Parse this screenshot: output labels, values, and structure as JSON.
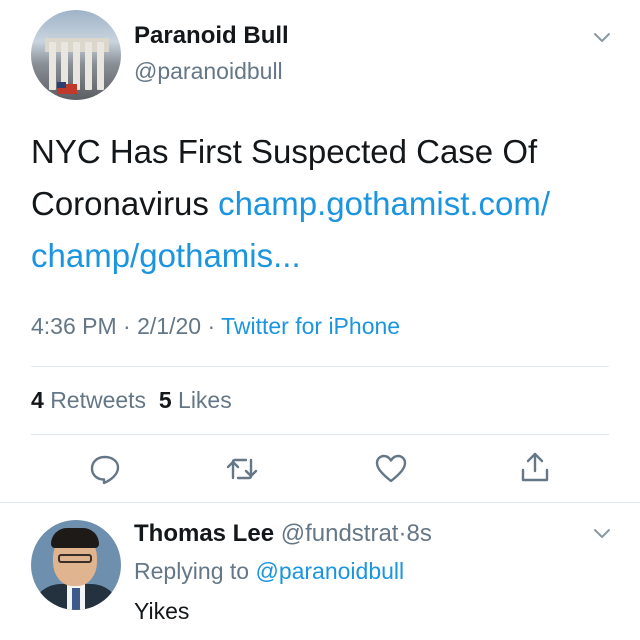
{
  "tweet": {
    "author_name": "Paranoid Bull",
    "author_handle": "@paranoidbull",
    "text": "NYC Has First Suspected Case Of Coronavirus ",
    "link_line1": "champ.gothamist.com/",
    "link_line2": "champ/gothamis...",
    "time": "4:36 PM",
    "separator": " · ",
    "date": "2/1/20",
    "source": "Twitter for iPhone",
    "retweet_count": "4",
    "retweet_label": "Retweets",
    "like_count": "5",
    "like_label": "Likes"
  },
  "reply": {
    "author_name": "Thomas Lee",
    "author_handle": "@fundstrat",
    "separator": "·",
    "age": "8s",
    "replying_prefix": "Replying to ",
    "replying_to": "@paranoidbull",
    "text": "Yikes"
  },
  "icons": {
    "menu": "chevron-down-icon",
    "reply": "comment-icon",
    "retweet": "retweet-icon",
    "like": "heart-icon",
    "share": "share-icon"
  },
  "colors": {
    "link": "#1b95e0",
    "secondary_text": "#657786",
    "primary_text": "#14171a",
    "divider": "#e1e8ed"
  }
}
